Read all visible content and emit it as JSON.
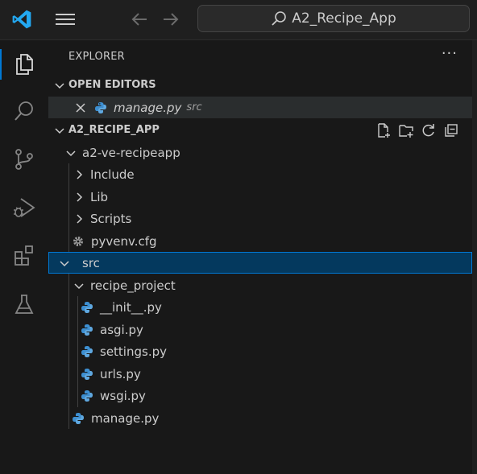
{
  "titlebar": {
    "command_center_text": "A2_Recipe_App"
  },
  "activity_bar": {
    "items": [
      {
        "icon": "files-icon",
        "active": true
      },
      {
        "icon": "search-icon",
        "active": false
      },
      {
        "icon": "source-control-icon",
        "active": false
      },
      {
        "icon": "run-debug-icon",
        "active": false
      },
      {
        "icon": "extensions-icon",
        "active": false
      },
      {
        "icon": "testing-flask-icon",
        "active": false
      }
    ]
  },
  "explorer": {
    "title": "EXPLORER",
    "more_label": "···",
    "open_editors": {
      "header": "OPEN EDITORS",
      "files": [
        {
          "name": "manage.py",
          "folder": "src"
        }
      ]
    },
    "workspace": {
      "header": "A2_RECIPE_APP",
      "tree": [
        {
          "label": "a2-ve-recipeapp",
          "kind": "folder",
          "expanded": true
        },
        {
          "label": "Include",
          "kind": "folder",
          "expanded": false
        },
        {
          "label": "Lib",
          "kind": "folder",
          "expanded": false
        },
        {
          "label": "Scripts",
          "kind": "folder",
          "expanded": false
        },
        {
          "label": "pyvenv.cfg",
          "kind": "config"
        },
        {
          "label": "src",
          "kind": "folder",
          "expanded": true,
          "selected": true
        },
        {
          "label": "recipe_project",
          "kind": "folder",
          "expanded": true
        },
        {
          "label": "__init__.py",
          "kind": "python"
        },
        {
          "label": "asgi.py",
          "kind": "python"
        },
        {
          "label": "settings.py",
          "kind": "python"
        },
        {
          "label": "urls.py",
          "kind": "python"
        },
        {
          "label": "wsgi.py",
          "kind": "python"
        },
        {
          "label": "manage.py",
          "kind": "python"
        }
      ]
    }
  },
  "colors": {
    "accent": "#0078d4",
    "selection": "#04395e",
    "python_blue": "#3d8fd1",
    "vscode_blue": "#23a9f2"
  }
}
